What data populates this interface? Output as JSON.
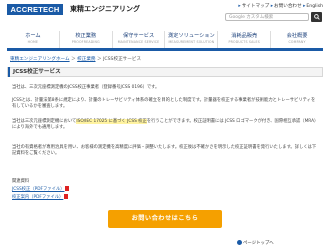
{
  "header": {
    "logo_text": "ACCRETECH",
    "company_name": "東精エンジニアリング",
    "utility_links": [
      "サイトマップ",
      "お問い合わせ",
      "English"
    ],
    "search_placeholder": "Google カスタム検索"
  },
  "nav": [
    {
      "label": "ホーム",
      "en": "HOME"
    },
    {
      "label": "校正業務",
      "en": "PROOFREADING"
    },
    {
      "label": "保守サービス",
      "en": "MAINTENANCE SERVICE"
    },
    {
      "label": "測定ソリューション",
      "en": "MEASUREMENT SOLUTION"
    },
    {
      "label": "消耗品販売",
      "en": "PRODUCTS SALES"
    },
    {
      "label": "会社概要",
      "en": "COMPANY"
    }
  ],
  "breadcrumb": {
    "home": "東精エンジニアリングホーム",
    "sep1": "＞",
    "section": "校正業務",
    "sep2": "＞",
    "current": "JCSS校正サービス"
  },
  "title": "JCSS校正サービス",
  "paragraphs": {
    "p1": "当社は、三次元座標測定機のJCSS校正事業者（登録番号JCSS 0196）です。",
    "p2": "JCSSとは、計量法第8条に規定により、計量のトレーサビリティ体系の確立を目的とした制度です。計量器を校正する事業者が技術能力とトレーサビリティを有しているかを審査します。",
    "p3a": "当社は三次元座標測定機において",
    "p3_highlight": "ISO/IEC 17025 に基づく JCSS 校正",
    "p3b": "を行うことができます。校正証明書には JCSS ロゴマークが付き、国際相互承認（MRA）により海外でも通用します。",
    "p4": "当社の有資格者が専用治具を用い、お客様の測定機を高精度に評価・調整いたします。校正後は不確かさを明示した校正証明書を発行いたします。詳しくは下記資料をご覧ください。"
  },
  "links": {
    "heading": "関連資料",
    "item1": "JCSS校正（PDFファイル）",
    "item2": "校正案内（PDFファイル）"
  },
  "cta_label": "お問い合わせはこちら",
  "pagetop_label": "ページトップへ",
  "colors": {
    "brand": "#1a5aa6",
    "cta": "#f5a000",
    "highlight": "#fff3a0"
  }
}
